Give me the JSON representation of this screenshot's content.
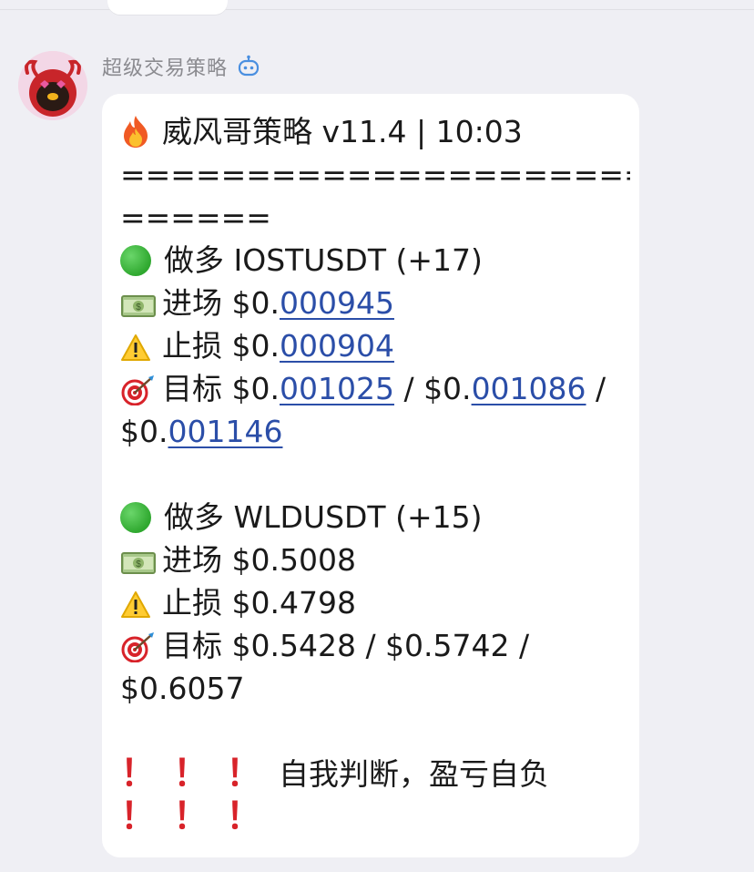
{
  "chat": {
    "sender": "超级交易策略",
    "title": "威风哥策略 v11.4 | 10:03",
    "separator_1": "============================",
    "separator_2": "======",
    "signal1": {
      "header": "做多 IOSTUSDT (+17)",
      "entry_label": "进场 $0.",
      "entry_value": "000945",
      "stop_label": "止损 $0.",
      "stop_value": "000904",
      "target_label": "目标 $0.",
      "target_1": "001025",
      "target_sep1": " / $0.",
      "target_2": "001086",
      "target_sep2": " /",
      "target_line2_prefix": "$0.",
      "target_3": "001146"
    },
    "signal2": {
      "header": "做多 WLDUSDT (+15)",
      "entry": "进场 $0.5008",
      "stop": "止损 $0.4798",
      "target_line1": "目标 $0.5428 / $0.5742 /",
      "target_line2": "$0.6057"
    },
    "disclaimer": "自我判断，盈亏自负",
    "bang": "！"
  },
  "icons": {
    "fire": "fire-icon",
    "green_circle": "green-circle-icon",
    "money": "money-banknote-icon",
    "warning": "warning-icon",
    "target": "target-icon",
    "exclamation": "red-exclamation-icon",
    "bot": "bot-icon"
  },
  "colors": {
    "link": "#2b4ea8",
    "exclamation": "#d8232a",
    "sender": "#8b8b90",
    "background": "#efeff4"
  }
}
